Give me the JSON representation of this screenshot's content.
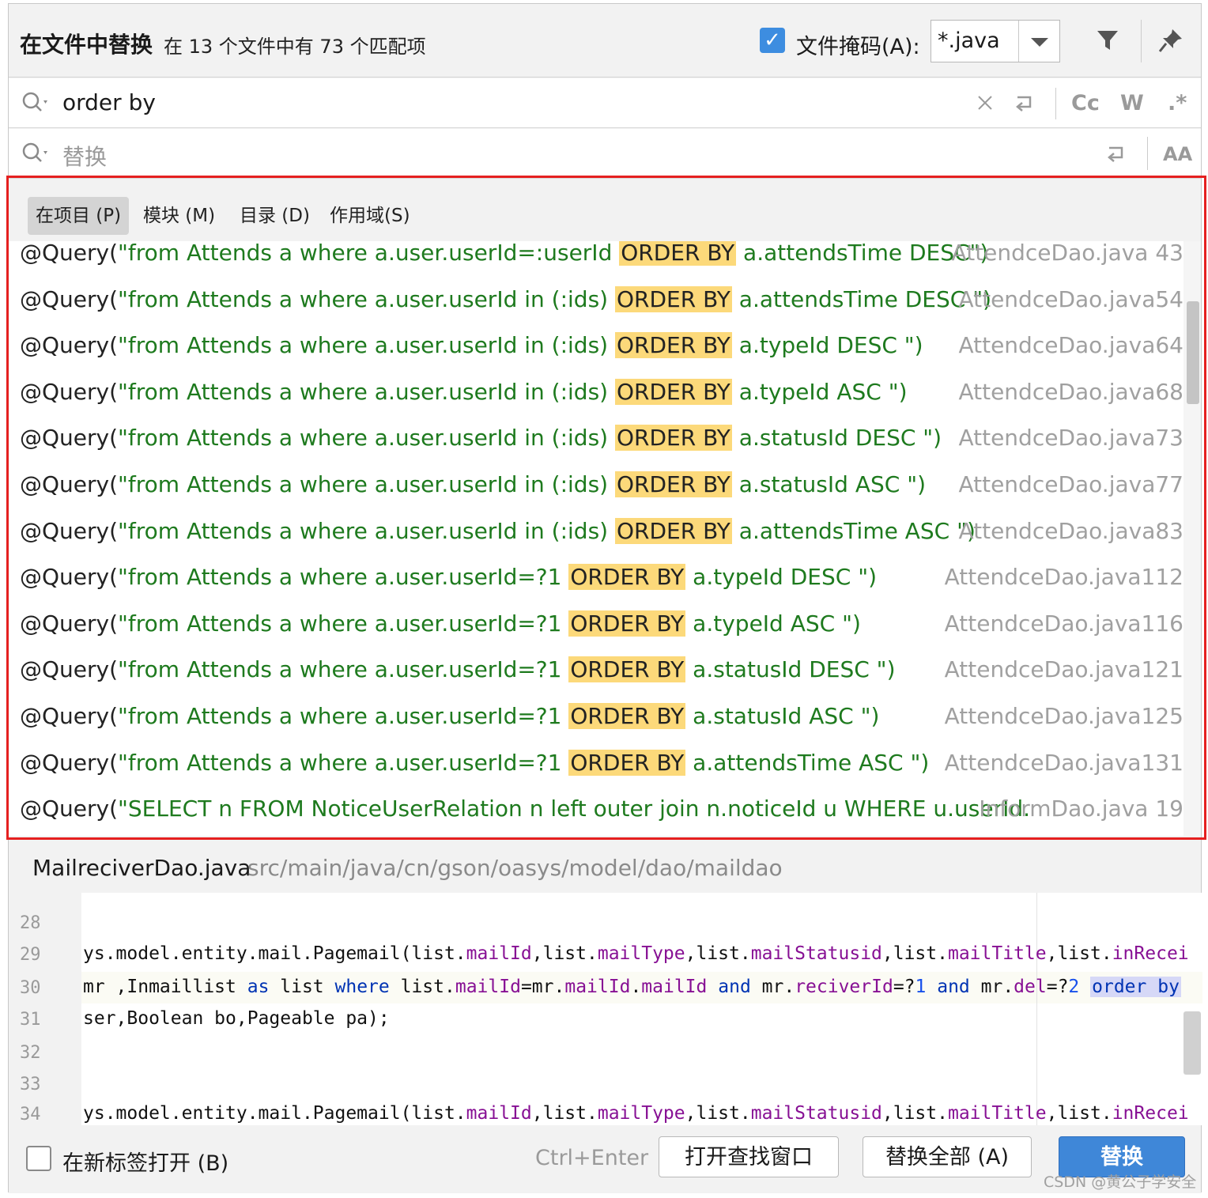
{
  "header": {
    "title": "在文件中替换",
    "subtitle": "在 13 个文件中有 73 个匹配项",
    "file_mask_label": "文件掩码(A):",
    "file_mask_value": "*.java",
    "file_mask_checked": true
  },
  "find": {
    "query": "order by",
    "options": [
      "Cc",
      "W",
      ".*"
    ]
  },
  "replace": {
    "placeholder": "替换",
    "options": [
      "AA"
    ]
  },
  "scope_tabs": [
    {
      "label": "在项目 (P)",
      "active": true
    },
    {
      "label": "模块 (M)",
      "active": false
    },
    {
      "label": "目录 (D)",
      "active": false
    },
    {
      "label": "作用域(S)",
      "active": false
    }
  ],
  "results": [
    {
      "ann": "@Query(",
      "pre": "\"from Attends a where a.user.userId=:userId ",
      "kw": "ORDER BY",
      "post": " a.attendsTime DESC\")",
      "file": "AttendceDao.java 43"
    },
    {
      "ann": "@Query(",
      "pre": "\"from Attends a where a.user.userId in (:ids) ",
      "kw": "ORDER BY",
      "post": " a.attendsTime DESC \")",
      "file": "AttendceDao.java54"
    },
    {
      "ann": "@Query(",
      "pre": "\"from Attends a where a.user.userId in (:ids) ",
      "kw": "ORDER BY",
      "post": " a.typeId DESC \")",
      "file": "AttendceDao.java64"
    },
    {
      "ann": "@Query(",
      "pre": "\"from Attends a where a.user.userId in (:ids)  ",
      "kw": "ORDER BY",
      "post": " a.typeId ASC \")",
      "file": "AttendceDao.java68"
    },
    {
      "ann": "@Query(",
      "pre": "\"from Attends a where a.user.userId in (:ids)  ",
      "kw": "ORDER BY",
      "post": " a.statusId DESC \")",
      "file": "AttendceDao.java73"
    },
    {
      "ann": "@Query(",
      "pre": "\"from Attends a where a.user.userId in (:ids)  ",
      "kw": "ORDER BY",
      "post": " a.statusId ASC \")",
      "file": "AttendceDao.java77"
    },
    {
      "ann": "@Query(",
      "pre": "\"from Attends a where a.user.userId in (:ids)  ",
      "kw": "ORDER BY",
      "post": " a.attendsTime ASC \")",
      "file": "AttendceDao.java83"
    },
    {
      "ann": "@Query(",
      "pre": "\"from Attends a where a.user.userId=?1  ",
      "kw": "ORDER BY",
      "post": " a.typeId DESC \")",
      "file": "AttendceDao.java112"
    },
    {
      "ann": "@Query(",
      "pre": "\"from Attends a where a.user.userId=?1  ",
      "kw": "ORDER BY",
      "post": " a.typeId ASC \")",
      "file": "AttendceDao.java116"
    },
    {
      "ann": "@Query(",
      "pre": "\"from Attends a where a.user.userId=?1  ",
      "kw": "ORDER BY",
      "post": " a.statusId DESC \")",
      "file": "AttendceDao.java121"
    },
    {
      "ann": "@Query(",
      "pre": "\"from Attends a where a.user.userId=?1  ",
      "kw": "ORDER BY",
      "post": " a.statusId ASC \")",
      "file": "AttendceDao.java125"
    },
    {
      "ann": "@Query(",
      "pre": "\"from Attends a where a.user.userId=?1  ",
      "kw": "ORDER BY",
      "post": " a.attendsTime ASC \")",
      "file": "AttendceDao.java131"
    },
    {
      "ann": "@Query(",
      "pre": "\"SELECT n FROM NoticeUserRelation n left outer join n.noticeId u WHERE u.userId.",
      "kw": "",
      "post": "",
      "file": "InformDao.java 19"
    }
  ],
  "preview": {
    "file": "MailreciverDao.java",
    "path": "src/main/java/cn/gson/oasys/model/dao/maildao"
  },
  "editor": {
    "line_numbers": [
      "28",
      "29",
      "30",
      "31",
      "32",
      "33",
      "34"
    ],
    "line29": {
      "a": "ys.model.entity.mail.Pagemail(list.",
      "f1": "mailId",
      "b": ",list.",
      "f2": "mailType",
      "c": ",list.",
      "f3": "mailStatusid",
      "d": ",list.",
      "f4": "mailTitle",
      "e": ",list.",
      "f5": "inRecei"
    },
    "line30": {
      "a": " mr ,Inmaillist ",
      "k1": "as",
      "b": " list ",
      "k2": "where",
      "c": " list.",
      "f1": "mailId",
      "d": "=mr.",
      "f2": "mailId",
      "e": ".",
      "f3": "mailId",
      "f": " ",
      "k3": "and",
      "g": " mr.",
      "f4": "reciverId",
      "h": "=?",
      "n1": "1",
      "i": " ",
      "k4": "and",
      "j": " mr.",
      "f5": "del",
      "k": "=?",
      "n2": "2",
      "l": " ",
      "hl": "order by"
    },
    "line31": "ser,Boolean bo,Pageable pa);",
    "line34": {
      "a": "ys.model.entity.mail.Pagemail(list.",
      "f1": "mailId",
      "b": ",list.",
      "f2": "mailType",
      "c": ",list.",
      "f3": "mailStatusid",
      "d": ",list.",
      "f4": "mailTitle",
      "e": ",list.",
      "f5": "inRecei"
    }
  },
  "footer": {
    "new_tab_label": "在新标签打开 (B)",
    "new_tab_checked": false,
    "shortcut": "Ctrl+Enter",
    "open_find_window": "打开查找窗口",
    "replace_all": "替换全部 (A)",
    "replace": "替换"
  },
  "watermark": "CSDN @黄公子学安全",
  "colors": {
    "highlight": "#fcd97a",
    "string_green": "#1e7a1e",
    "primary_button": "#3f87d8",
    "red_annotation_box": "#e52020"
  }
}
